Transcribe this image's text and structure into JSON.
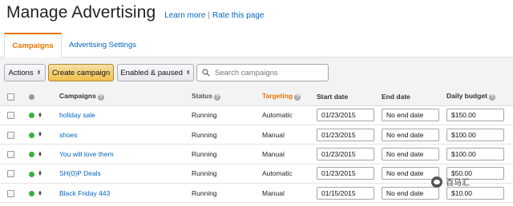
{
  "header": {
    "title": "Manage Advertising",
    "learn_more": "Learn more",
    "separator": "|",
    "rate_page": "Rate this page"
  },
  "tabs": [
    {
      "label": "Campaigns",
      "active": true
    },
    {
      "label": "Advertising Settings",
      "active": false
    }
  ],
  "toolbar": {
    "actions_label": "Actions",
    "create_label": "Create campaign",
    "filter_label": "Enabled & paused",
    "search_placeholder": "Search campaigns"
  },
  "table": {
    "columns": {
      "campaigns": "Campaigns",
      "status": "Status",
      "targeting": "Targeting",
      "start_date": "Start date",
      "end_date": "End date",
      "daily_budget": "Daily budget"
    },
    "rows": [
      {
        "name": "holiday sale",
        "status": "Running",
        "targeting": "Automatic",
        "start_date": "01/23/2015",
        "end_date": "No end date",
        "budget": "$150.00"
      },
      {
        "name": "shoes",
        "status": "Running",
        "targeting": "Manual",
        "start_date": "01/23/2015",
        "end_date": "No end date",
        "budget": "$100.00"
      },
      {
        "name": "You will love them",
        "status": "Running",
        "targeting": "Manual",
        "start_date": "01/23/2015",
        "end_date": "No end date",
        "budget": "$100.00"
      },
      {
        "name": "SH(0)P Deals",
        "status": "Running",
        "targeting": "Automatic",
        "start_date": "01/23/2015",
        "end_date": "No end date",
        "budget": "$50.00"
      },
      {
        "name": "Black Friday 443",
        "status": "Running",
        "targeting": "Manual",
        "start_date": "01/15/2015",
        "end_date": "No end date",
        "budget": "$10.00"
      }
    ]
  },
  "watermark": {
    "text": "百马汇"
  },
  "colors": {
    "accent": "#e77600",
    "link": "#0066c0",
    "running": "#3ab13a",
    "create_button": "#f0c14b"
  },
  "icons": {
    "search": "search-icon",
    "help": "help-icon",
    "status_dot": "status-dot-icon",
    "sort": "sort-icon"
  }
}
